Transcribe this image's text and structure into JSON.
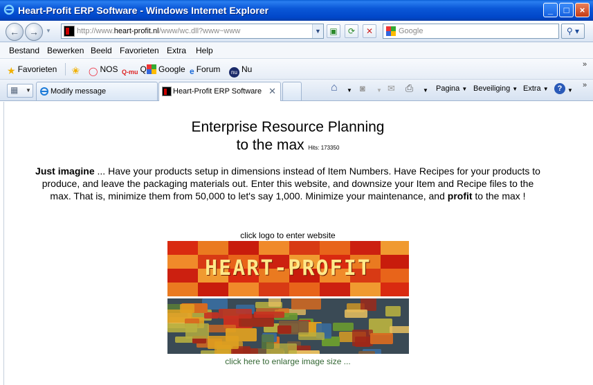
{
  "window": {
    "title": "Heart-Profit ERP Software - Windows Internet Explorer"
  },
  "address": {
    "url_prefix": "http://www.",
    "url_domain": "heart-profit.nl",
    "url_suffix": "/www/wc.dll?www~www",
    "search_placeholder": "Google"
  },
  "menu": {
    "items": [
      "Bestand",
      "Bewerken",
      "Beeld",
      "Favorieten",
      "Extra",
      "Help"
    ]
  },
  "favorites": {
    "label": "Favorieten",
    "links": [
      "NOS",
      "Q",
      "Google",
      "Forum",
      "Nu"
    ]
  },
  "tabs": [
    {
      "label": "Modify message",
      "active": false
    },
    {
      "label": "Heart-Profit ERP Software",
      "active": true
    }
  ],
  "commands": {
    "page": "Pagina",
    "security": "Beveiliging",
    "extra": "Extra"
  },
  "page": {
    "heading_line1": "Enterprise Resource Planning",
    "heading_line2": "to the max",
    "hits": "Hits: 173350",
    "intro_bold1": "Just imagine",
    "intro_text1": " ... Have your products setup in dimensions instead of Item Numbers. Have Recipes for your products to produce, and leave the packaging materials out. Enter this website, and downsize your Item and Recipe files to the max. That is, minimize them from 50,000 to let's say 1,000. Minimize your maintenance, and ",
    "intro_bold2": "profit",
    "intro_text2": " to the max !",
    "click_logo": "click logo to enter website",
    "logo_text": "HEART-PROFIT",
    "enlarge": "click here to enlarge image size ..."
  },
  "colors": {
    "titlebar": "#0b58d8",
    "link_green": "#336633",
    "logo_red": "#d92a10",
    "logo_orange": "#ea7a20",
    "logo_text": "#ffe98a"
  }
}
